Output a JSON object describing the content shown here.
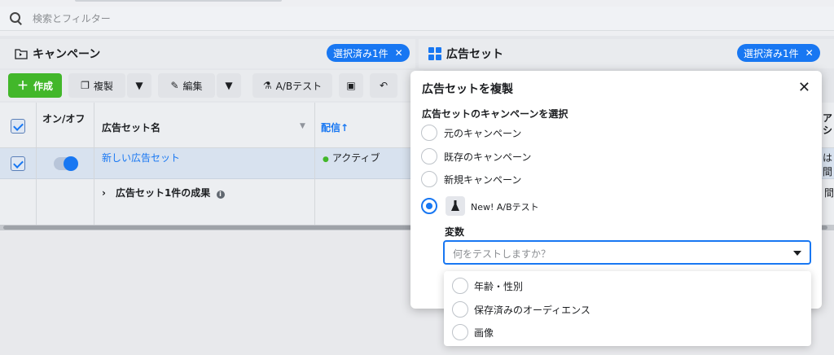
{
  "search": {
    "placeholder": "検索とフィルター"
  },
  "campaign_panel": {
    "title": "キャンペーン",
    "pill": "選択済み1件"
  },
  "adset_panel": {
    "title": "広告セット",
    "pill": "選択済み1件"
  },
  "toolbar": {
    "create": "作成",
    "duplicate": "複製",
    "edit": "編集",
    "ab_test": "A/Bテスト"
  },
  "table": {
    "col_onoff": "オン/オフ",
    "col_name": "広告セット名",
    "col_delivery": "配信↑",
    "col_right_partial": "ア\nシ",
    "row": {
      "name": "新しい広告セット",
      "delivery": "アクティブ",
      "right_partial": "は間"
    },
    "summary": {
      "label": "広告セット1件の成果",
      "right_partial": "間"
    }
  },
  "modal": {
    "title": "広告セットを複製",
    "section": "広告セットのキャンペーンを選択",
    "options": [
      "元のキャンペーン",
      "既存のキャンペーン",
      "新規キャンペーン"
    ],
    "ab_option": "New! A/Bテスト",
    "variable_label": "変数",
    "variable_placeholder": "何をテストしますか？",
    "dropdown": [
      "年齢・性別",
      "保存済みのオーディエンス",
      "画像"
    ]
  },
  "colors": {
    "accent": "#1877f2",
    "create": "#42b72a"
  }
}
